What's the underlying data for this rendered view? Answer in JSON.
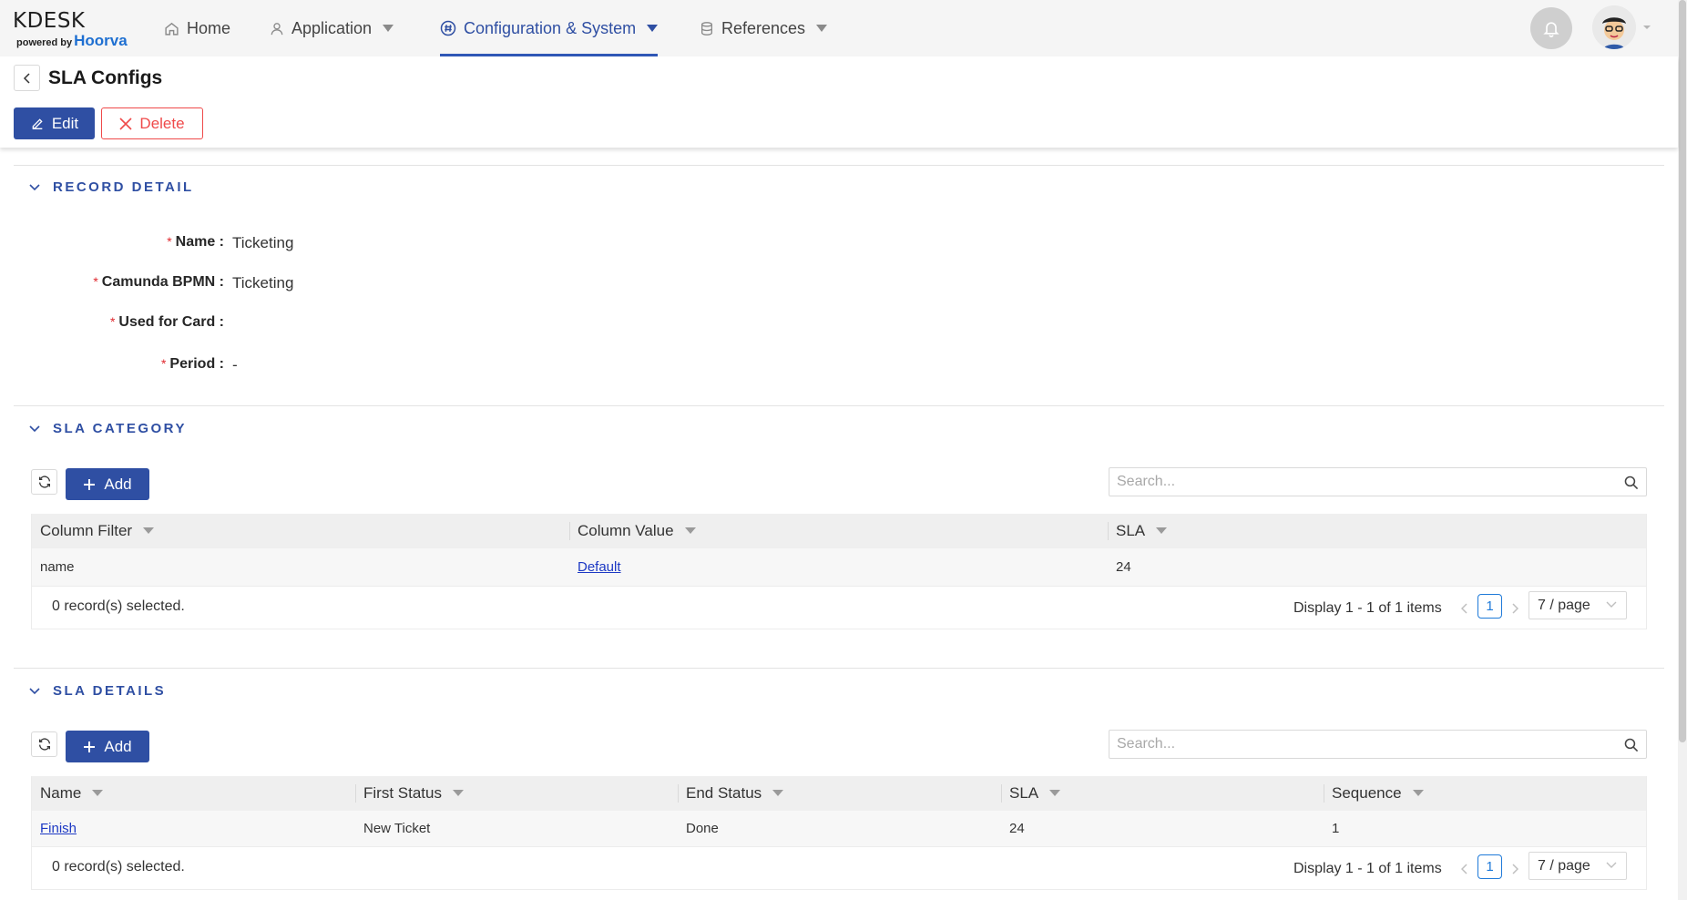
{
  "logo": {
    "main": "KDESK",
    "powered": "powered by",
    "brand": "Hoorva"
  },
  "nav": {
    "home": "Home",
    "application": "Application",
    "configuration": "Configuration & System",
    "references": "References"
  },
  "page": {
    "title": "SLA Configs",
    "edit_label": "Edit",
    "delete_label": "Delete"
  },
  "record_detail": {
    "title": "RECORD DETAIL",
    "fields": [
      {
        "label": "Name",
        "value": "Ticketing"
      },
      {
        "label": "Camunda BPMN",
        "value": "Ticketing"
      },
      {
        "label": "Used for Card",
        "value": ""
      },
      {
        "label": "Period",
        "value": "-"
      }
    ]
  },
  "sla_category": {
    "title": "SLA CATEGORY",
    "add_label": "Add",
    "search_placeholder": "Search...",
    "columns": [
      "Column Filter",
      "Column Value",
      "SLA"
    ],
    "rows": [
      {
        "column_filter": "name",
        "column_value": "Default",
        "sla": "24"
      }
    ],
    "selected_text": "0 record(s) selected.",
    "display_text": "Display 1 - 1 of 1 items",
    "current_page": "1",
    "page_size": "7 / page"
  },
  "sla_details": {
    "title": "SLA DETAILS",
    "add_label": "Add",
    "search_placeholder": "Search...",
    "columns": [
      "Name",
      "First Status",
      "End Status",
      "SLA",
      "Sequence"
    ],
    "rows": [
      {
        "name": "Finish",
        "first_status": "New Ticket",
        "end_status": "Done",
        "sla": "24",
        "sequence": "1"
      }
    ],
    "selected_text": "0 record(s) selected.",
    "display_text": "Display 1 - 1 of 1 items",
    "current_page": "1",
    "page_size": "7 / page"
  },
  "colors": {
    "primary": "#2f4fa3",
    "danger": "#ef4a4a",
    "link": "#1d39c4",
    "required": "#e0282e"
  }
}
